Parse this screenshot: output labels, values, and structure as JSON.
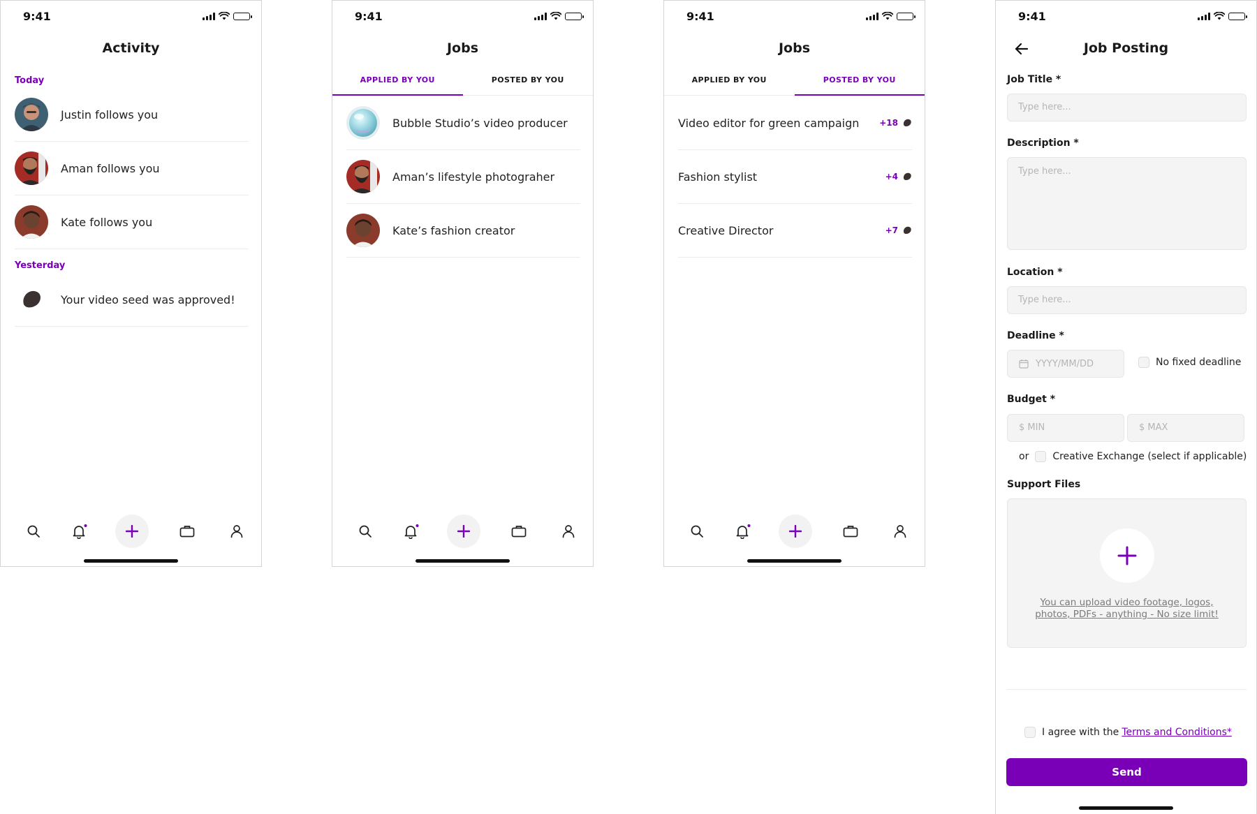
{
  "status_bar": {
    "time": "9:41"
  },
  "colors": {
    "accent": "#7a00b8",
    "field_bg": "#f4f4f4",
    "divider": "#ececec"
  },
  "icons": {
    "status": [
      "signal-icon",
      "wifi-icon",
      "battery-icon"
    ],
    "tab_bar": [
      "search-icon",
      "bell-icon",
      "plus-icon",
      "briefcase-icon",
      "user-icon"
    ],
    "back": "arrow-left-icon",
    "calendar": "calendar-icon",
    "seed": "seed-icon"
  },
  "activity": {
    "title": "Activity",
    "today_label": "Today",
    "yesterday_label": "Yesterday",
    "today_items": [
      {
        "text": "Justin follows you"
      },
      {
        "text": "Aman follows you"
      },
      {
        "text": "Kate follows you"
      }
    ],
    "yesterday_items": [
      {
        "text": "Your video seed was approved!"
      }
    ]
  },
  "jobs_applied": {
    "title": "Jobs",
    "tabs": [
      "APPLIED BY YOU",
      "POSTED BY YOU"
    ],
    "active_tab": "APPLIED BY YOU",
    "items": [
      {
        "title": "Bubble Studio’s video producer"
      },
      {
        "title": "Aman’s lifestyle photograher"
      },
      {
        "title": "Kate’s fashion creator"
      }
    ]
  },
  "jobs_posted": {
    "title": "Jobs",
    "tabs": [
      "APPLIED BY YOU",
      "POSTED BY YOU"
    ],
    "active_tab": "POSTED BY YOU",
    "items": [
      {
        "title": "Video editor for green campaign",
        "count": "+18"
      },
      {
        "title": "Fashion stylist",
        "count": "+4"
      },
      {
        "title": "Creative Director",
        "count": "+7"
      }
    ]
  },
  "job_posting": {
    "title": "Job Posting",
    "job_title_label": "Job Title *",
    "job_title_placeholder": "Type here...",
    "description_label": "Description *",
    "description_placeholder": "Type here...",
    "location_label": "Location *",
    "location_placeholder": "Type here...",
    "deadline_label": "Deadline *",
    "deadline_placeholder": "YYYY/MM/DD",
    "no_deadline_label": "No fixed deadline",
    "budget_label": "Budget *",
    "budget_min_placeholder": "$ MIN",
    "budget_max_placeholder": "$ MAX",
    "or_label": "or",
    "creative_exchange_label": "Creative Exchange (select if applicable)",
    "support_files_label": "Support Files",
    "upload_hint": "You can upload video footage, logos, photos, PDFs - anything - No size limit!",
    "agree_prefix": "I agree with the",
    "terms_link": "Terms and Conditions*",
    "send_label": "Send"
  }
}
